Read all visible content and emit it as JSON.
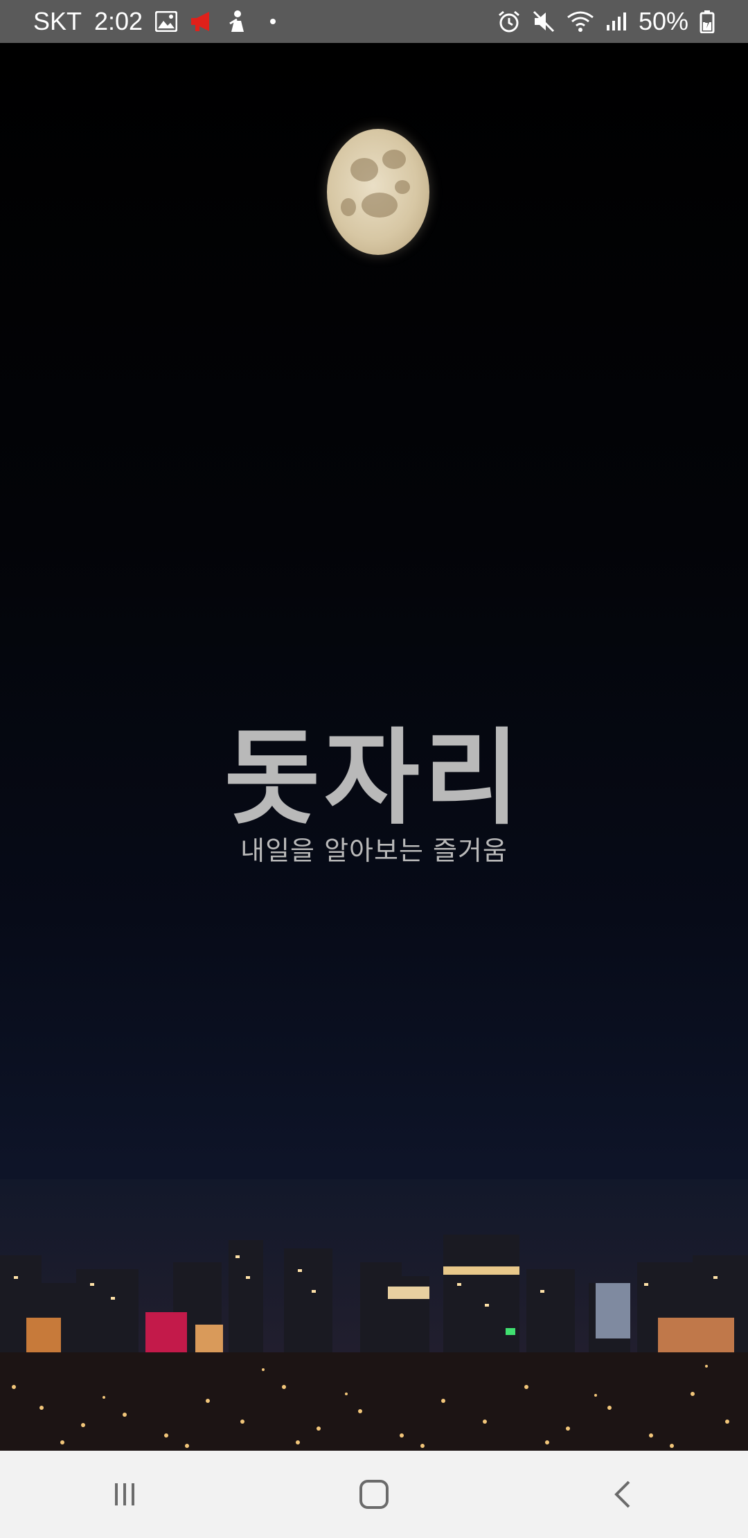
{
  "status_bar": {
    "carrier": "SKT",
    "time": "2:02",
    "battery": "50%",
    "icons_left": [
      "image-icon",
      "megaphone-icon",
      "figure-icon",
      "dot-icon"
    ],
    "icons_right": [
      "alarm-icon",
      "mute-icon",
      "wifi-icon",
      "signal-icon",
      "battery-icon"
    ]
  },
  "splash": {
    "app_title": "돗자리",
    "tagline": "내일을 알아보는 즐거움"
  },
  "nav_bar": {
    "buttons": [
      "recent-apps",
      "home",
      "back"
    ]
  },
  "colors": {
    "status_bar_bg": "#5a5a5a",
    "title_text": "#b9b9b9",
    "nav_bar_bg": "#f2f2f2",
    "megaphone_red": "#e0201a"
  }
}
